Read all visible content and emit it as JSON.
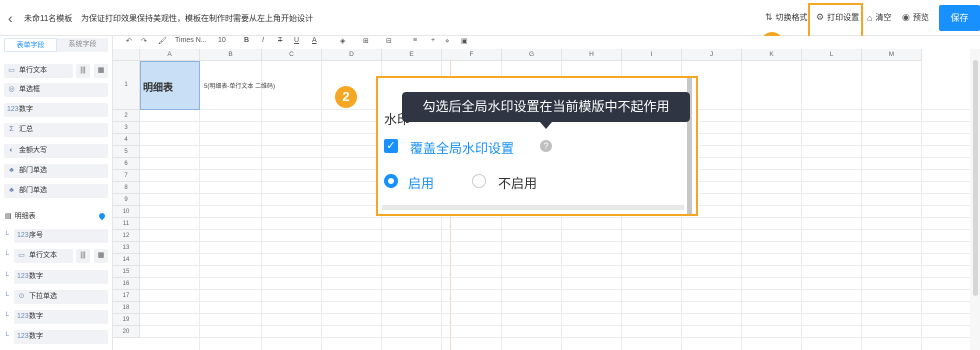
{
  "header": {
    "template_name": "未命11名模板",
    "note": "为保证打印效果保持美观性，模板在制作时需要从左上角开始设计",
    "actions": {
      "switch_format": "切换格式",
      "print_settings": "打印设置",
      "clear": "清空",
      "preview": "预览"
    },
    "save": "保存"
  },
  "badges": [
    "1",
    "2"
  ],
  "left_panel": {
    "tabs": [
      "表单字段",
      "系统字段"
    ],
    "fields": [
      "单行文本",
      "单选框",
      "数字",
      "汇总",
      "金额大写",
      "部门单选",
      "部门单选"
    ],
    "detail_group": "明细表",
    "detail_fields": [
      "序号",
      "单行文本",
      "数字",
      "下拉单选",
      "数字",
      "数字"
    ]
  },
  "toolbar": {
    "font": "Times N...",
    "size": "10",
    "bold": "B",
    "italic": "I",
    "strike": "T",
    "underline": "U",
    "color": "A"
  },
  "grid": {
    "columns": [
      "A",
      "B",
      "C",
      "D",
      "E",
      "F",
      "G",
      "H",
      "I",
      "J",
      "K",
      "L",
      "M"
    ],
    "rows": [
      "1",
      "2",
      "3",
      "4",
      "5",
      "6",
      "7",
      "8",
      "9",
      "10",
      "11",
      "12",
      "13",
      "14",
      "15",
      "16",
      "17",
      "18",
      "19",
      "20"
    ],
    "cell_a1": "明细表",
    "cell_b1": "5(明细表-单行文本 二维码)"
  },
  "dialog": {
    "title": "水印",
    "override_label": "覆盖全局水印设置",
    "help": "?",
    "enable": "启用",
    "disable": "不启用",
    "tooltip": "勾选后全局水印设置在当前模版中不起作用"
  },
  "colors": {
    "accent": "#1890ff",
    "highlight": "#f5a623",
    "tooltip_bg": "#2f3542"
  }
}
